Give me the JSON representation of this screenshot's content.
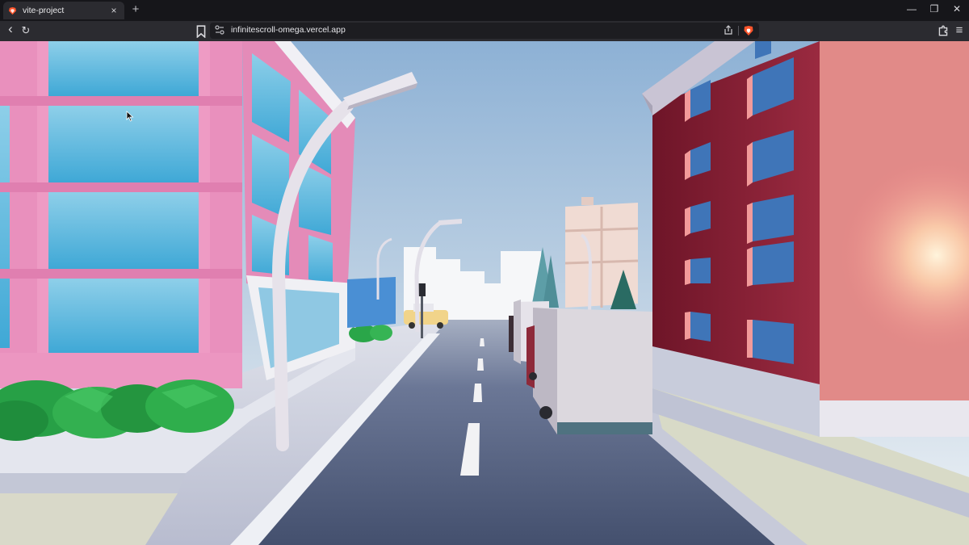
{
  "browser": {
    "tab": {
      "title": "vite-project",
      "close_glyph": "×",
      "favicon": "brave-lion-icon"
    },
    "new_tab_glyph": "+",
    "window_controls": {
      "minimize": "—",
      "restore": "❐",
      "close": "✕"
    },
    "toolbar": {
      "back_glyph": "‹",
      "reload_glyph": "↻",
      "bookmark_glyph": "🔖",
      "url": "infinitescroll-omega.vercel.app",
      "tune_glyph": "⚲",
      "share_glyph": "⇪",
      "extensions_glyph": "✣",
      "menu_glyph": "≡"
    }
  },
  "scene": {
    "description_kind": "webgl-canvas",
    "colors": {
      "sky_top": "#8fb3d6",
      "sky_bottom": "#e8eef4",
      "pink_building": "#e98bb8",
      "glass": "#56b6dc",
      "red_building": "#8e2036",
      "road": "#4b5877",
      "sidewalk": "#c9ccdc",
      "bush": "#2ea84a",
      "truck": "#d9d6dc"
    }
  }
}
